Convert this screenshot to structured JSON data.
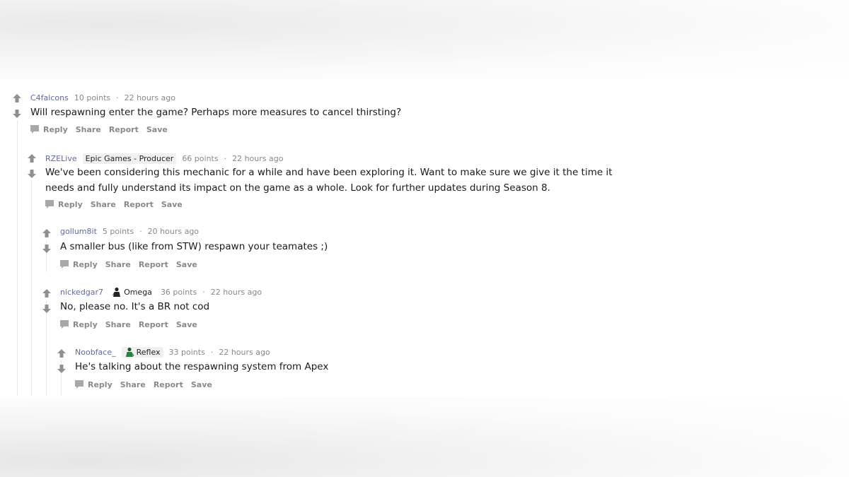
{
  "comments": [
    {
      "author": "C4falcons",
      "flair": "",
      "points": "10 points",
      "time": "22 hours ago",
      "lines": [
        "Will respawning enter the game? Perhaps more measures to cancel thirsting?"
      ]
    },
    {
      "author": "RZELive",
      "flair": "Epic Games - Producer",
      "points": "66 points",
      "time": "22 hours ago",
      "lines": [
        "We've been considering this mechanic for a while and have been exploring it. Want to make sure we give it the time it",
        "needs and fully understand its impact on the game as a whole. Look for further updates during Season 8."
      ]
    },
    {
      "author": "gollum8it",
      "flair": "",
      "points": "5 points",
      "time": "20 hours ago",
      "lines": [
        "A smaller bus (like from STW) respawn your teamates ;)"
      ]
    },
    {
      "author": "nickedgar7",
      "flair": "Omega",
      "flair_icon": "omega-skin-icon",
      "points": "36 points",
      "time": "22 hours ago",
      "lines": [
        "No, please no. It's a BR not cod"
      ]
    },
    {
      "author": "Noobface_",
      "flair": "Reflex",
      "flair_icon": "reflex-skin-icon",
      "points": "33 points",
      "time": "22 hours ago",
      "lines": [
        "He's talking about the respawning system from Apex"
      ]
    }
  ],
  "meta_separator": "·",
  "actions": {
    "reply": "Reply",
    "share": "Share",
    "report": "Report",
    "save": "Save"
  },
  "icons": {
    "upvote": "upvote-arrow-icon",
    "downvote": "downvote-arrow-icon",
    "reply": "chat-bubble-icon"
  },
  "colors": {
    "author": "#5f6a99",
    "meta": "#888888",
    "arrow": "#909090",
    "text": "#1a1a1b"
  }
}
